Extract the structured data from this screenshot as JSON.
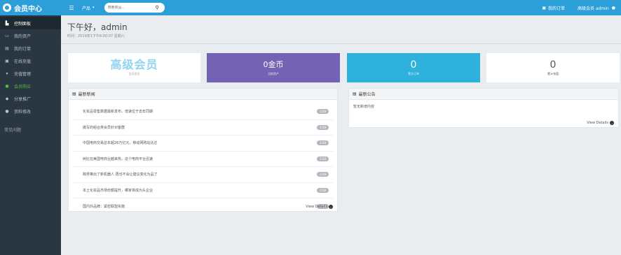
{
  "app": {
    "logo_text": "会员中心"
  },
  "sidebar": {
    "items": [
      {
        "label": "控制面板",
        "icon": "dashboard-icon",
        "glyph": "▙"
      },
      {
        "label": "我的资产",
        "icon": "wallet-icon",
        "glyph": "▭"
      },
      {
        "label": "我的订单",
        "icon": "orders-icon",
        "glyph": "▤"
      },
      {
        "label": "在线充值",
        "icon": "recharge-icon",
        "glyph": "▣"
      },
      {
        "label": "充值管理",
        "icon": "filter-icon",
        "glyph": "▾"
      },
      {
        "label": "会员购买",
        "icon": "user-plus-icon",
        "glyph": "●"
      },
      {
        "label": "分享推广",
        "icon": "share-icon",
        "glyph": "◆"
      },
      {
        "label": "资料修改",
        "icon": "profile-icon",
        "glyph": "●"
      }
    ],
    "faq": "常见问题"
  },
  "topbar": {
    "menu_glyph": "☰",
    "product_menu": "产品",
    "search_placeholder": "搜索商品...",
    "orders_label": "我的订单",
    "user_label": "高级会员 admin"
  },
  "header": {
    "greeting": "下午好，admin",
    "time_line": "时间：2019年1下午6:00:07 星期六"
  },
  "stats": [
    {
      "value": "高级会员",
      "label": "会员类型"
    },
    {
      "value": "0金币",
      "label": "当前资产"
    },
    {
      "value": "0",
      "label": "累计订单"
    },
    {
      "value": "0",
      "label": "累计充值"
    }
  ],
  "news": {
    "title": "最新新闻",
    "items": [
      {
        "title": "化妆品零售数据最新发布，增速位于去年同期",
        "badge": "1/18"
      },
      {
        "title": "做写的组合类会员针对客群",
        "badge": "1/18"
      },
      {
        "title": "中国电商交易总年超26万亿元，移动网购站比达",
        "badge": "1/18"
      },
      {
        "title": "树比在美国电商业越来热，这个电商平台迅速",
        "badge": "1/18"
      },
      {
        "title": "跨界推出了新机器人 再也不会让建议变化为品了",
        "badge": "1/18"
      },
      {
        "title": "本土化妆品市场份额提升，哪家将成为头企业",
        "badge": "1/18"
      },
      {
        "title": "国内外品牌：紧密联盟实施",
        "badge": "1/18"
      }
    ],
    "view_details": "View Details"
  },
  "notice": {
    "title": "最新公告",
    "body": "暂无新增内容",
    "view_details": "View Details"
  },
  "colors": {
    "sidebar_bg": "#2a3641",
    "topbar_bg": "#2d9fd8",
    "card_purple": "#7462b5",
    "card_blue": "#2fb1de",
    "active_green": "#4fc04a"
  }
}
